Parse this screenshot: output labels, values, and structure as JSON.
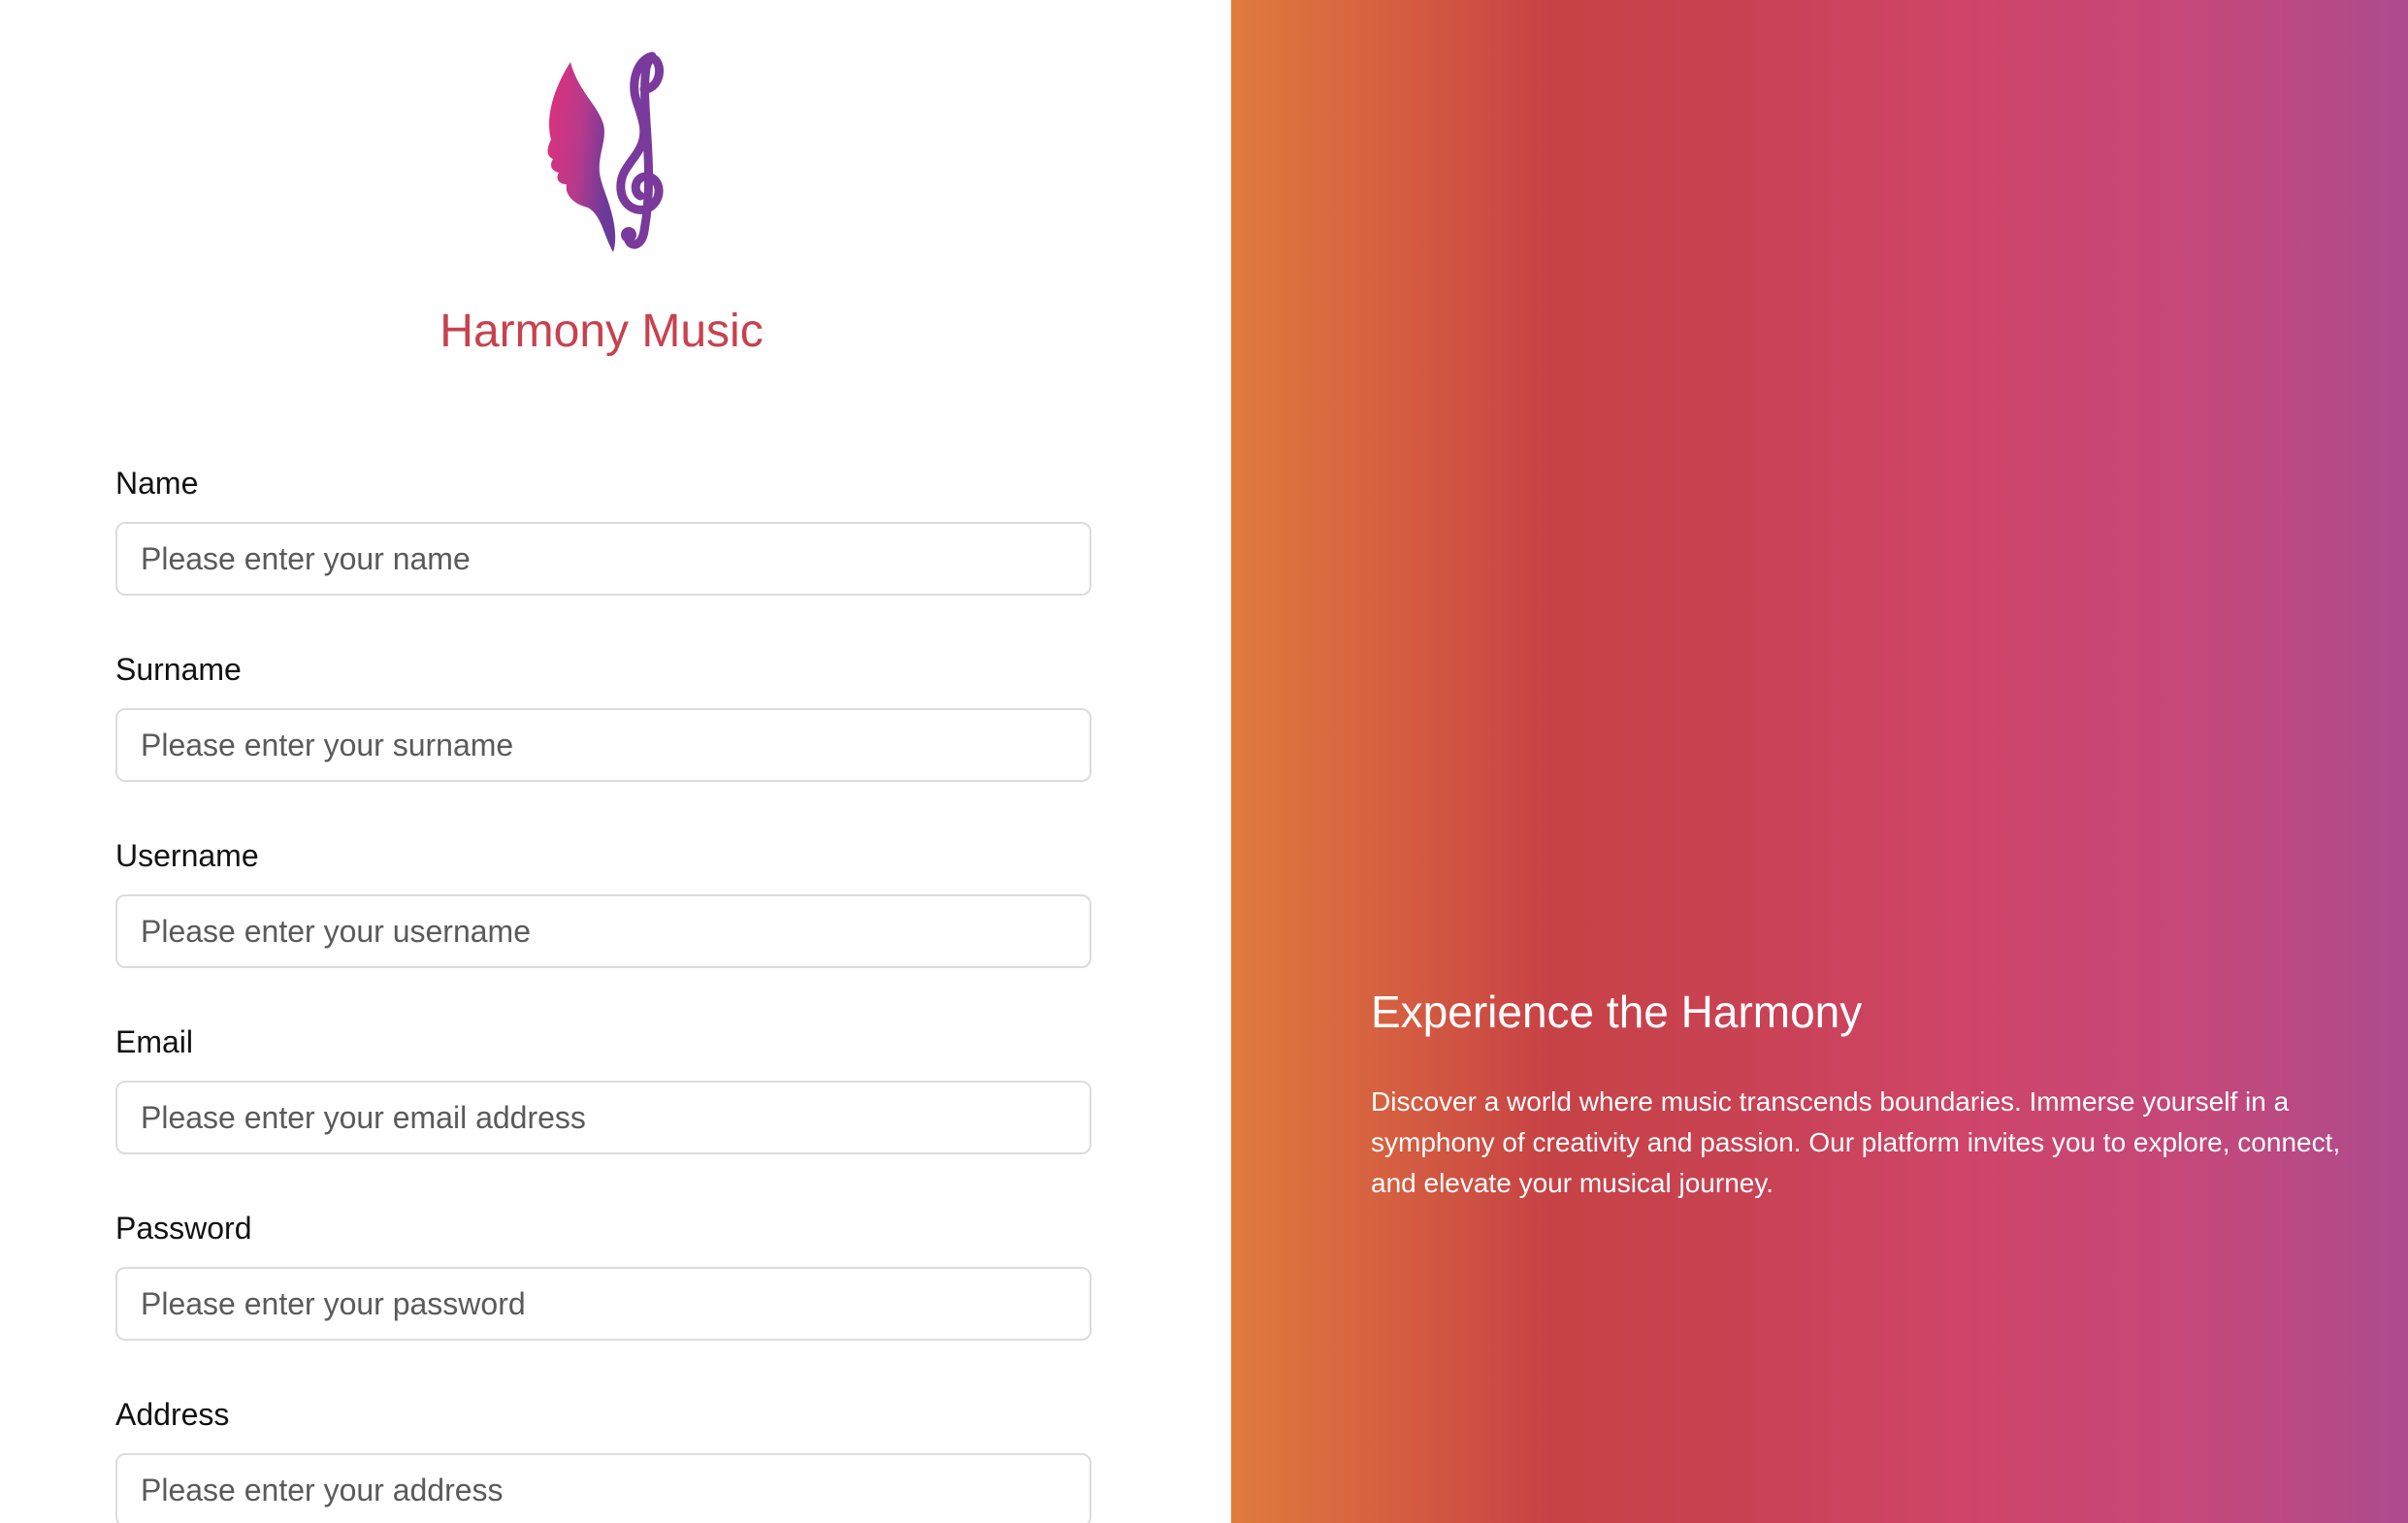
{
  "brand": {
    "name": "Harmony Music",
    "logo_icon": "face-treble-clef-logo",
    "color": "#c8414e"
  },
  "form": {
    "fields": [
      {
        "label": "Name",
        "placeholder": "Please enter your name",
        "value": ""
      },
      {
        "label": "Surname",
        "placeholder": "Please enter your surname",
        "value": ""
      },
      {
        "label": "Username",
        "placeholder": "Please enter your username",
        "value": ""
      },
      {
        "label": "Email",
        "placeholder": "Please enter your email address",
        "value": ""
      },
      {
        "label": "Password",
        "placeholder": "Please enter your password",
        "value": ""
      },
      {
        "label": "Address",
        "placeholder": "Please enter your address",
        "value": ""
      }
    ]
  },
  "hero": {
    "title": "Experience the Harmony",
    "text": "Discover a world where music transcends boundaries. Immerse yourself in a symphony of creativity and passion. Our platform invites you to explore, connect, and elevate your musical journey.",
    "gradient_colors": [
      "#e07b3d",
      "#c74245",
      "#cf4468",
      "#ad4b8e"
    ]
  }
}
